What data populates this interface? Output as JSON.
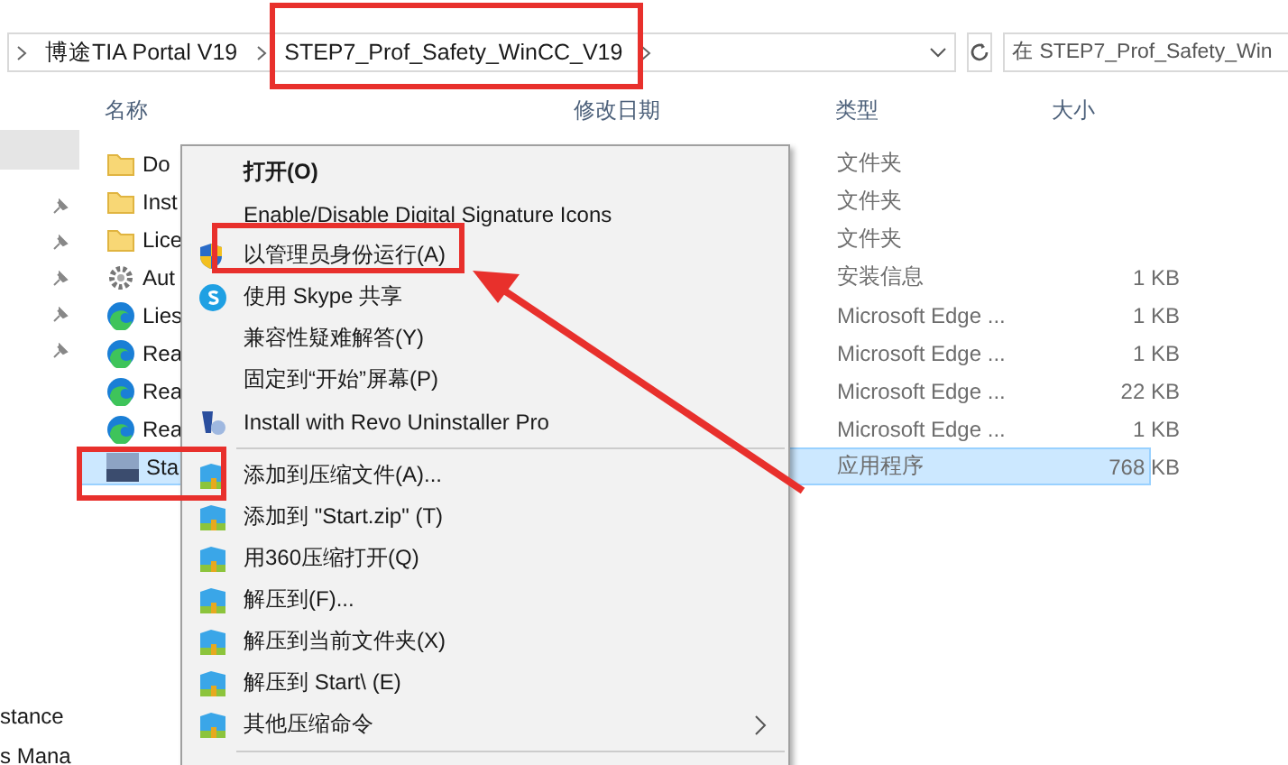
{
  "address_bar": {
    "breadcrumbs": [
      "博途TIA Portal V19",
      "STEP7_Prof_Safety_WinCC_V19"
    ]
  },
  "search": {
    "placeholder": "在 STEP7_Prof_Safety_Win"
  },
  "columns": [
    "名称",
    "修改日期",
    "类型",
    "大小"
  ],
  "sidebar": {
    "items": [
      {
        "kind": "blank",
        "selected": true
      },
      {
        "kind": "text",
        "label": "stance",
        "selected": false
      },
      {
        "kind": "text",
        "label": "s Mana",
        "selected": false
      }
    ]
  },
  "files": [
    {
      "name": "Do",
      "kind": "folder",
      "type": "文件夹",
      "selected": false
    },
    {
      "name": "Inst",
      "kind": "folder",
      "type": "文件夹",
      "selected": false
    },
    {
      "name": "Lice",
      "kind": "folder",
      "type": "文件夹",
      "selected": false
    },
    {
      "name": "Aut",
      "kind": "setup",
      "type": "安装信息",
      "size": "1 KB",
      "selected": false
    },
    {
      "name": "Lies",
      "kind": "edge",
      "type": "Microsoft Edge ...",
      "size": "1 KB",
      "selected": false
    },
    {
      "name": "Rea",
      "kind": "edge",
      "type": "Microsoft Edge ...",
      "size": "1 KB",
      "selected": false
    },
    {
      "name": "Rea",
      "kind": "edge",
      "type": "Microsoft Edge ...",
      "size": "22 KB",
      "selected": false
    },
    {
      "name": "Rea",
      "kind": "edge",
      "type": "Microsoft Edge ...",
      "size": "1 KB",
      "selected": false
    },
    {
      "name": "Sta",
      "kind": "app",
      "type": "应用程序",
      "size": "768 KB",
      "selected": true
    }
  ],
  "context_menu": {
    "items": [
      {
        "label": "打开(O)",
        "kind": "default"
      },
      {
        "label": "Enable/Disable Digital Signature Icons",
        "kind": "plain"
      },
      {
        "label": "以管理员身份运行(A)",
        "kind": "shield"
      },
      {
        "label": "使用 Skype 共享",
        "kind": "skype"
      },
      {
        "label": "兼容性疑难解答(Y)",
        "kind": "plain"
      },
      {
        "label": "固定到“开始”屏幕(P)",
        "kind": "plain"
      },
      {
        "label": "Install with Revo Uninstaller Pro",
        "kind": "revo"
      },
      {
        "label": "添加到压缩文件(A)...",
        "kind": "archive",
        "group_start": true
      },
      {
        "label": "添加到 \"Start.zip\" (T)",
        "kind": "archive"
      },
      {
        "label": "用360压缩打开(Q)",
        "kind": "archive"
      },
      {
        "label": "解压到(F)...",
        "kind": "archive"
      },
      {
        "label": "解压到当前文件夹(X)",
        "kind": "archive"
      },
      {
        "label": "解压到 Start\\ (E)",
        "kind": "archive"
      },
      {
        "label": "其他压缩命令",
        "kind": "archive",
        "submenu": true
      }
    ]
  }
}
